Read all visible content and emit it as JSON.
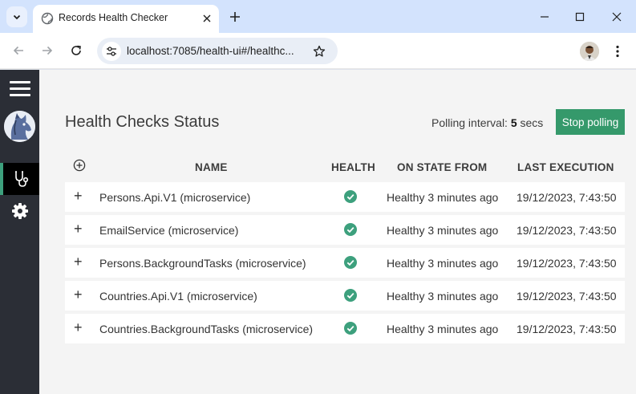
{
  "browser": {
    "tab_title": "Records Health Checker",
    "url": "localhost:7085/health-ui#/healthc..."
  },
  "header": {
    "title": "Health Checks Status",
    "polling_label": "Polling interval: ",
    "polling_value": "5",
    "polling_unit": " secs",
    "stop_button": "Stop polling"
  },
  "table": {
    "columns": [
      "NAME",
      "HEALTH",
      "ON STATE FROM",
      "LAST EXECUTION"
    ],
    "rows": [
      {
        "name": "Persons.Api.V1 (microservice)",
        "health": "healthy",
        "on_state_from": "Healthy 3 minutes ago",
        "last_execution": "19/12/2023, 7:43:50"
      },
      {
        "name": "EmailService (microservice)",
        "health": "healthy",
        "on_state_from": "Healthy 3 minutes ago",
        "last_execution": "19/12/2023, 7:43:50"
      },
      {
        "name": "Persons.BackgroundTasks (microservice)",
        "health": "healthy",
        "on_state_from": "Healthy 3 minutes ago",
        "last_execution": "19/12/2023, 7:43:50"
      },
      {
        "name": "Countries.Api.V1 (microservice)",
        "health": "healthy",
        "on_state_from": "Healthy 3 minutes ago",
        "last_execution": "19/12/2023, 7:43:50"
      },
      {
        "name": "Countries.BackgroundTasks (microservice)",
        "health": "healthy",
        "on_state_from": "Healthy 3 minutes ago",
        "last_execution": "19/12/2023, 7:43:50"
      }
    ],
    "expand_symbol": "+"
  },
  "colors": {
    "accent": "#35996b",
    "sidebar": "#2b2e36",
    "healthy": "#3da07d"
  },
  "icons": {
    "sidebar": [
      "hamburger-menu-icon",
      "app-logo",
      "stethoscope-icon",
      "gear-icon"
    ],
    "health": "check-circle-icon"
  }
}
